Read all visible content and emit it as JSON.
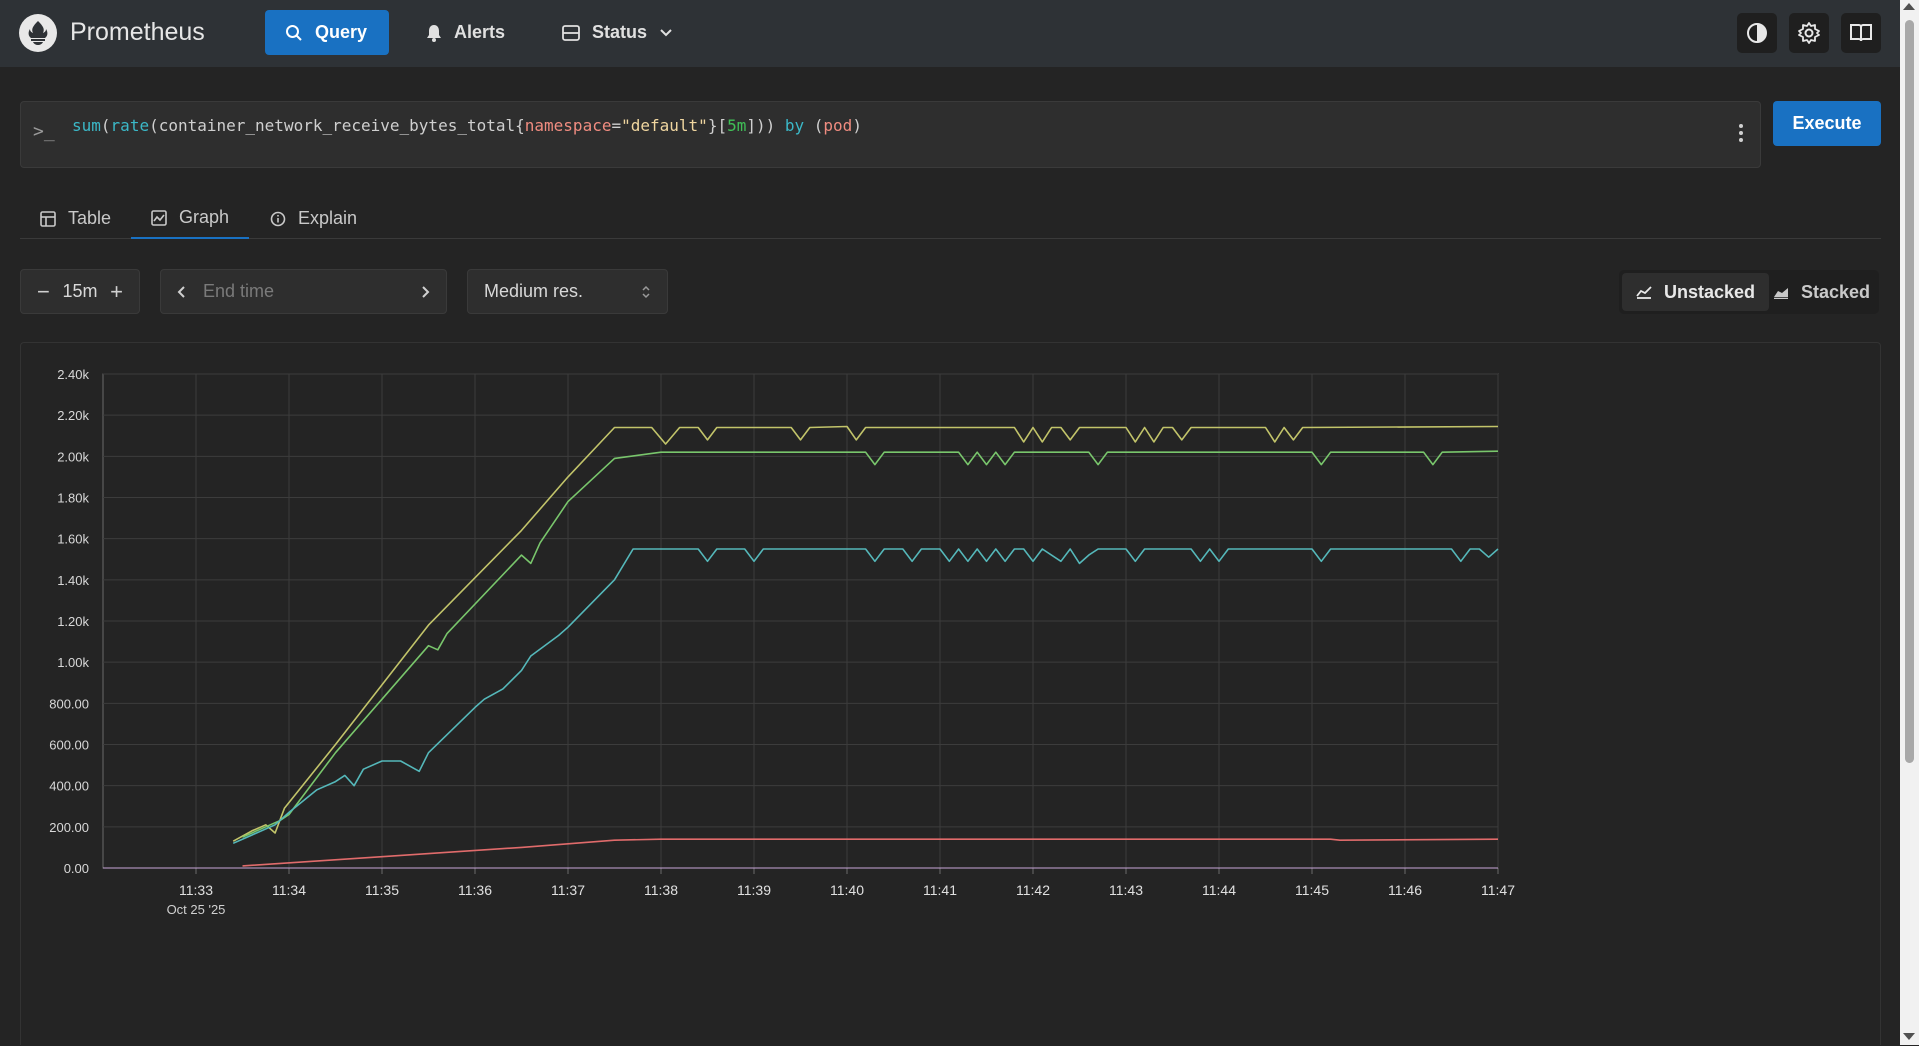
{
  "header": {
    "brand": "Prometheus",
    "nav": [
      {
        "label": "Query",
        "icon": "search-icon",
        "active": true
      },
      {
        "label": "Alerts",
        "icon": "bell-icon",
        "active": false
      },
      {
        "label": "Status",
        "icon": "server-icon",
        "active": false
      }
    ],
    "right_icons": [
      "theme-toggle-icon",
      "gear-icon",
      "book-icon"
    ]
  },
  "query": {
    "prompt": ">_",
    "parts": {
      "fn1": "sum",
      "p1": "(",
      "fn2": "rate",
      "p2": "(container_network_receive_bytes_total{",
      "label": "namespace",
      "eq": "=",
      "str": "\"default\"",
      "p3": "}[",
      "dur": "5m",
      "p4": "])) ",
      "by": "by",
      "p5": " (",
      "grp": "pod",
      "p6": ")"
    }
  },
  "execute_label": "Execute",
  "tabs": [
    {
      "label": "Table",
      "icon": "table-icon",
      "active": false
    },
    {
      "label": "Graph",
      "icon": "graph-icon",
      "active": true
    },
    {
      "label": "Explain",
      "icon": "info-icon",
      "active": false
    }
  ],
  "controls": {
    "range": "15m",
    "end_time_placeholder": "End time",
    "resolution": "Medium res.",
    "unstacked_label": "Unstacked",
    "stacked_label": "Stacked",
    "mode": "unstacked"
  },
  "colors": {
    "accent": "#1971c2",
    "series_yellow": "#c2c46a",
    "series_green": "#79c66c",
    "series_teal": "#55b8ba",
    "series_red": "#e06b6b"
  },
  "chart_data": {
    "type": "line",
    "title": "",
    "xlabel": "",
    "ylabel": "",
    "date_label": "Oct 25 '25",
    "ylim": [
      0,
      2400
    ],
    "y_ticks": [
      {
        "v": 0,
        "label": "0.00"
      },
      {
        "v": 200,
        "label": "200.00"
      },
      {
        "v": 400,
        "label": "400.00"
      },
      {
        "v": 600,
        "label": "600.00"
      },
      {
        "v": 800,
        "label": "800.00"
      },
      {
        "v": 1000,
        "label": "1.00k"
      },
      {
        "v": 1200,
        "label": "1.20k"
      },
      {
        "v": 1400,
        "label": "1.40k"
      },
      {
        "v": 1600,
        "label": "1.60k"
      },
      {
        "v": 1800,
        "label": "1.80k"
      },
      {
        "v": 2000,
        "label": "2.00k"
      },
      {
        "v": 2200,
        "label": "2.20k"
      },
      {
        "v": 2400,
        "label": "2.40k"
      }
    ],
    "x_ticks": [
      "11:33",
      "11:34",
      "11:35",
      "11:36",
      "11:37",
      "11:38",
      "11:39",
      "11:40",
      "11:41",
      "11:42",
      "11:43",
      "11:44",
      "11:45",
      "11:46",
      "11:47"
    ],
    "x_range_minutes": [
      0,
      15
    ],
    "x_unit": "minutes after 11:32:00",
    "grid": true,
    "series": [
      {
        "color": "#c2c46a",
        "points": [
          [
            1.4,
            130
          ],
          [
            1.6,
            180
          ],
          [
            1.75,
            210
          ],
          [
            1.85,
            170
          ],
          [
            1.95,
            290
          ],
          [
            2.5,
            600
          ],
          [
            3.5,
            1180
          ],
          [
            4.5,
            1640
          ],
          [
            5.0,
            1900
          ],
          [
            5.5,
            2140
          ],
          [
            5.9,
            2140
          ],
          [
            6.05,
            2060
          ],
          [
            6.2,
            2140
          ],
          [
            6.4,
            2140
          ],
          [
            6.5,
            2080
          ],
          [
            6.6,
            2140
          ],
          [
            7.4,
            2140
          ],
          [
            7.5,
            2080
          ],
          [
            7.6,
            2140
          ],
          [
            8.0,
            2145
          ],
          [
            8.1,
            2080
          ],
          [
            8.2,
            2140
          ],
          [
            9.8,
            2140
          ],
          [
            9.9,
            2070
          ],
          [
            10.0,
            2140
          ],
          [
            10.1,
            2070
          ],
          [
            10.2,
            2140
          ],
          [
            10.3,
            2140
          ],
          [
            10.4,
            2080
          ],
          [
            10.5,
            2140
          ],
          [
            11.0,
            2140
          ],
          [
            11.1,
            2070
          ],
          [
            11.2,
            2140
          ],
          [
            11.3,
            2070
          ],
          [
            11.4,
            2140
          ],
          [
            11.5,
            2140
          ],
          [
            11.6,
            2080
          ],
          [
            11.7,
            2140
          ],
          [
            12.5,
            2140
          ],
          [
            12.6,
            2070
          ],
          [
            12.7,
            2140
          ],
          [
            12.8,
            2080
          ],
          [
            12.9,
            2140
          ],
          [
            15.0,
            2145
          ]
        ]
      },
      {
        "color": "#79c66c",
        "points": [
          [
            1.5,
            150
          ],
          [
            1.75,
            200
          ],
          [
            1.9,
            230
          ],
          [
            2.0,
            260
          ],
          [
            2.5,
            560
          ],
          [
            3.0,
            820
          ],
          [
            3.5,
            1080
          ],
          [
            3.6,
            1060
          ],
          [
            3.7,
            1140
          ],
          [
            4.5,
            1520
          ],
          [
            4.6,
            1480
          ],
          [
            4.7,
            1580
          ],
          [
            5.0,
            1780
          ],
          [
            5.5,
            1990
          ],
          [
            6.0,
            2020
          ],
          [
            8.2,
            2020
          ],
          [
            8.3,
            1960
          ],
          [
            8.4,
            2020
          ],
          [
            9.2,
            2020
          ],
          [
            9.3,
            1960
          ],
          [
            9.4,
            2020
          ],
          [
            9.5,
            1960
          ],
          [
            9.6,
            2020
          ],
          [
            9.7,
            1960
          ],
          [
            9.8,
            2020
          ],
          [
            10.6,
            2020
          ],
          [
            10.7,
            1960
          ],
          [
            10.8,
            2020
          ],
          [
            13.0,
            2020
          ],
          [
            13.1,
            1960
          ],
          [
            13.2,
            2020
          ],
          [
            14.2,
            2020
          ],
          [
            14.3,
            1960
          ],
          [
            14.4,
            2020
          ],
          [
            15.0,
            2025
          ]
        ]
      },
      {
        "color": "#55b8ba",
        "points": [
          [
            1.4,
            120
          ],
          [
            1.6,
            160
          ],
          [
            1.85,
            210
          ],
          [
            2.0,
            270
          ],
          [
            2.3,
            380
          ],
          [
            2.5,
            420
          ],
          [
            2.6,
            450
          ],
          [
            2.7,
            400
          ],
          [
            2.8,
            480
          ],
          [
            3.0,
            520
          ],
          [
            3.2,
            520
          ],
          [
            3.4,
            470
          ],
          [
            3.5,
            560
          ],
          [
            4.0,
            780
          ],
          [
            4.1,
            820
          ],
          [
            4.3,
            870
          ],
          [
            4.5,
            960
          ],
          [
            4.6,
            1030
          ],
          [
            4.9,
            1130
          ],
          [
            5.0,
            1170
          ],
          [
            5.5,
            1400
          ],
          [
            5.7,
            1550
          ],
          [
            6.4,
            1550
          ],
          [
            6.5,
            1490
          ],
          [
            6.6,
            1550
          ],
          [
            6.9,
            1550
          ],
          [
            7.0,
            1490
          ],
          [
            7.1,
            1550
          ],
          [
            8.2,
            1550
          ],
          [
            8.3,
            1490
          ],
          [
            8.4,
            1550
          ],
          [
            8.6,
            1550
          ],
          [
            8.7,
            1490
          ],
          [
            8.8,
            1550
          ],
          [
            9.0,
            1550
          ],
          [
            9.1,
            1490
          ],
          [
            9.2,
            1550
          ],
          [
            9.3,
            1490
          ],
          [
            9.4,
            1550
          ],
          [
            9.5,
            1490
          ],
          [
            9.6,
            1550
          ],
          [
            9.7,
            1490
          ],
          [
            9.8,
            1550
          ],
          [
            9.9,
            1550
          ],
          [
            10.0,
            1490
          ],
          [
            10.1,
            1550
          ],
          [
            10.3,
            1490
          ],
          [
            10.4,
            1550
          ],
          [
            10.5,
            1480
          ],
          [
            10.6,
            1520
          ],
          [
            10.7,
            1550
          ],
          [
            11.0,
            1550
          ],
          [
            11.1,
            1490
          ],
          [
            11.2,
            1550
          ],
          [
            11.7,
            1550
          ],
          [
            11.8,
            1490
          ],
          [
            11.9,
            1550
          ],
          [
            12.0,
            1490
          ],
          [
            12.1,
            1550
          ],
          [
            13.0,
            1550
          ],
          [
            13.1,
            1490
          ],
          [
            13.2,
            1550
          ],
          [
            14.5,
            1550
          ],
          [
            14.6,
            1490
          ],
          [
            14.7,
            1550
          ],
          [
            14.8,
            1550
          ],
          [
            14.9,
            1510
          ],
          [
            15.0,
            1550
          ]
        ]
      },
      {
        "color": "#e06b6b",
        "points": [
          [
            1.5,
            10
          ],
          [
            3.0,
            55
          ],
          [
            4.5,
            100
          ],
          [
            5.5,
            135
          ],
          [
            6.0,
            140
          ],
          [
            9.0,
            140
          ],
          [
            13.0,
            140
          ],
          [
            13.2,
            140
          ],
          [
            13.3,
            135
          ],
          [
            15.0,
            140
          ]
        ]
      }
    ]
  }
}
